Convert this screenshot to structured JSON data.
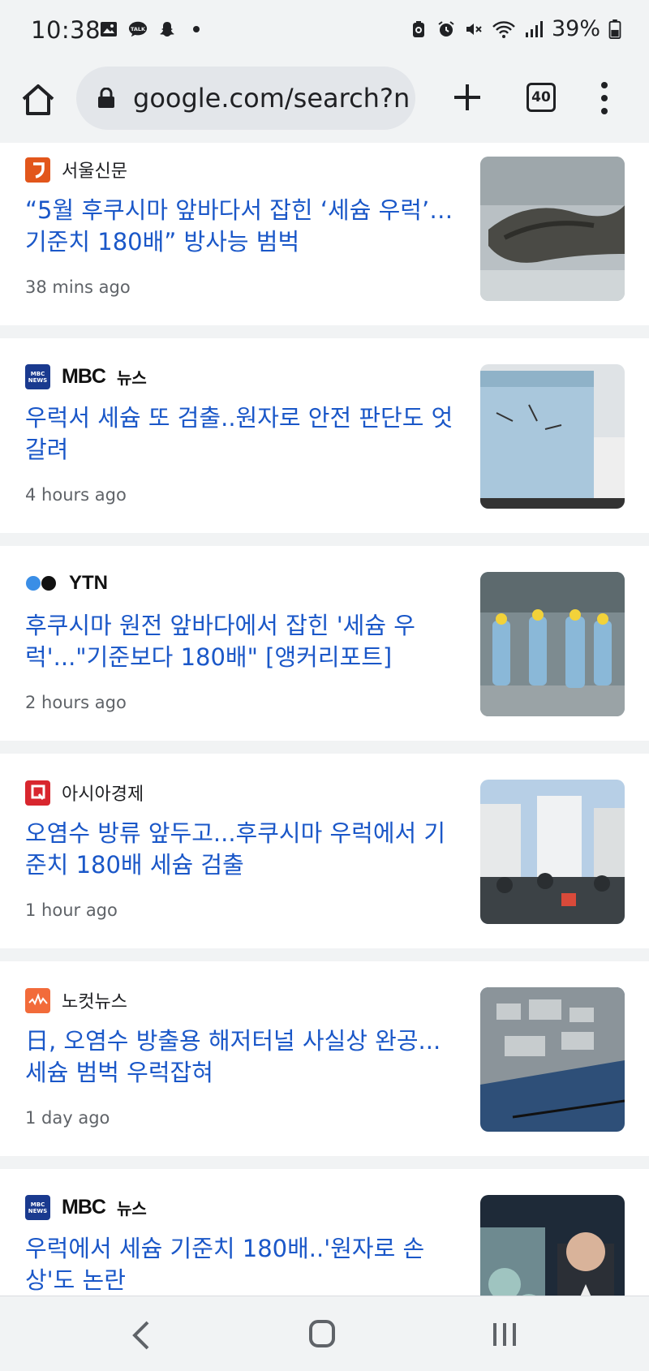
{
  "status": {
    "time": "10:38",
    "battery_pct": "39%",
    "left_icons": [
      "gallery-icon",
      "talk-icon",
      "snapchat-icon",
      "dot-icon"
    ],
    "right_icons": [
      "battery-saver-icon",
      "alarm-icon",
      "mute-icon",
      "wifi-icon",
      "signal-icon",
      "battery-icon"
    ]
  },
  "toolbar": {
    "url": "google.com/search?ne",
    "tab_count": "40"
  },
  "articles": [
    {
      "source": "서울신문",
      "logo": "seoul-shinmun",
      "headline": "“5월 후쿠시마 앞바다서 잡힌 ‘세슘 우럭’… 기준치 180배” 방사능 범벅",
      "time": "38 mins ago",
      "thumb": "fish-on-ice"
    },
    {
      "source": "MBC 뉴스",
      "logo": "mbc",
      "logo_word": "MBC",
      "logo_suffix": "뉴스",
      "headline": "우럭서 세슘 또 검출..원자로 안전 판단도 엇갈려",
      "time": "4 hours ago",
      "thumb": "blue-bucket"
    },
    {
      "source": "YTN",
      "logo": "ytn",
      "headline": "후쿠시마 원전 앞바다에서 잡힌 '세슘 우럭'...\"기준보다 180배\" [앵커리포트]",
      "time": "2 hours ago",
      "thumb": "workers-in-suits"
    },
    {
      "source": "아시아경제",
      "logo": "asia-economy",
      "headline": "오염수 방류 앞두고...후쿠시마 우럭에서 기준치 180배 세슘 검출",
      "time": "1 hour ago",
      "thumb": "storage-tanks"
    },
    {
      "source": "노컷뉴스",
      "logo": "nocut",
      "headline": "日, 오염수 방출용 해저터널 사실상 완공... 세슘 범벅 우럭잡혀",
      "time": "1 day ago",
      "thumb": "aerial-plant"
    },
    {
      "source": "MBC 뉴스",
      "logo": "mbc",
      "logo_word": "MBC",
      "logo_suffix": "뉴스",
      "headline": "우럭에서 세슘 기준치 180배..'원자로 손상'도 논란",
      "time": "",
      "thumb": "news-anchor"
    }
  ],
  "colors": {
    "headline": "#1a57c8",
    "page_bg": "#f1f3f4",
    "card_bg": "#ffffff"
  }
}
